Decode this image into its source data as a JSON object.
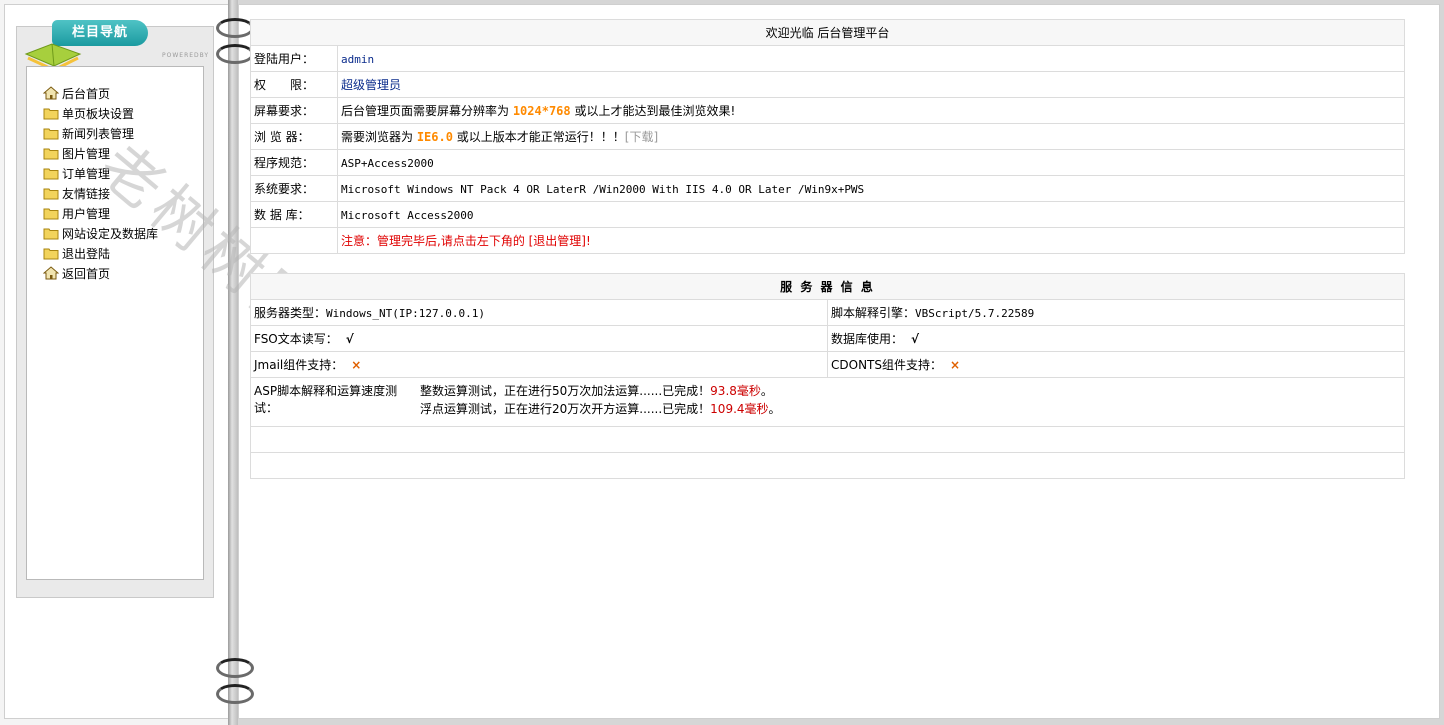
{
  "nav": {
    "title": "栏目导航",
    "powered": "POWEREDBY",
    "items": [
      {
        "label": "后台首页",
        "icon": "home-icon"
      },
      {
        "label": "单页板块设置",
        "icon": "folder-icon"
      },
      {
        "label": "新闻列表管理",
        "icon": "folder-icon"
      },
      {
        "label": "图片管理",
        "icon": "folder-icon"
      },
      {
        "label": "订单管理",
        "icon": "folder-icon"
      },
      {
        "label": "友情链接",
        "icon": "folder-icon"
      },
      {
        "label": "用户管理",
        "icon": "folder-icon"
      },
      {
        "label": "网站设定及数据库",
        "icon": "folder-icon"
      },
      {
        "label": "退出登陆",
        "icon": "folder-icon"
      },
      {
        "label": "返回首页",
        "icon": "home-icon"
      }
    ]
  },
  "watermark": "老树树网络",
  "welcome": {
    "title": "欢迎光临 后台管理平台",
    "rows": {
      "user": {
        "label": "登陆用户：",
        "value": "admin"
      },
      "perm": {
        "label": "权　　限：",
        "value": "超级管理员"
      },
      "screen": {
        "label": "屏幕要求：",
        "pre": "后台管理页面需要屏幕分辨率为 ",
        "highlight": "1024*768",
        "post": " 或以上才能达到最佳浏览效果!"
      },
      "browser": {
        "label": "浏 览 器：",
        "pre": "需要浏览器为 ",
        "highlight": "IE6.0",
        "post": " 或以上版本才能正常运行！！！",
        "download": "[下载]"
      },
      "program": {
        "label": "程序规范：",
        "value": "ASP+Access2000"
      },
      "system": {
        "label": "系统要求：",
        "value": "Microsoft Windows NT Pack 4 OR LaterR /Win2000 With IIS 4.0 OR Later /Win9x+PWS"
      },
      "db": {
        "label": "数 据 库：",
        "value": "Microsoft Access2000"
      },
      "notice": {
        "value": "注意：管理完毕后,请点击左下角的 [退出管理]!"
      }
    }
  },
  "server": {
    "title": "服 务 器 信 息",
    "type_label": "服务器类型：",
    "type_value": "Windows_NT(IP:127.0.0.1)",
    "engine_label": "脚本解释引擎：",
    "engine_value": "VBScript/5.7.22589",
    "fso_label": "FSO文本读写：",
    "fso_value": "√",
    "dbuse_label": "数据库使用：",
    "dbuse_value": "√",
    "jmail_label": "Jmail组件支持：",
    "jmail_value": "×",
    "cdonts_label": "CDONTS组件支持：",
    "cdonts_value": "×",
    "speed_label": "ASP脚本解释和运算速度测试：",
    "int_test": "整数运算测试，正在进行50万次加法运算......已完成！",
    "int_time": "93.8毫秒",
    "float_test": "浮点运算测试，正在进行20万次开方运算......已完成！",
    "float_time": "109.4毫秒",
    "period": "。"
  }
}
